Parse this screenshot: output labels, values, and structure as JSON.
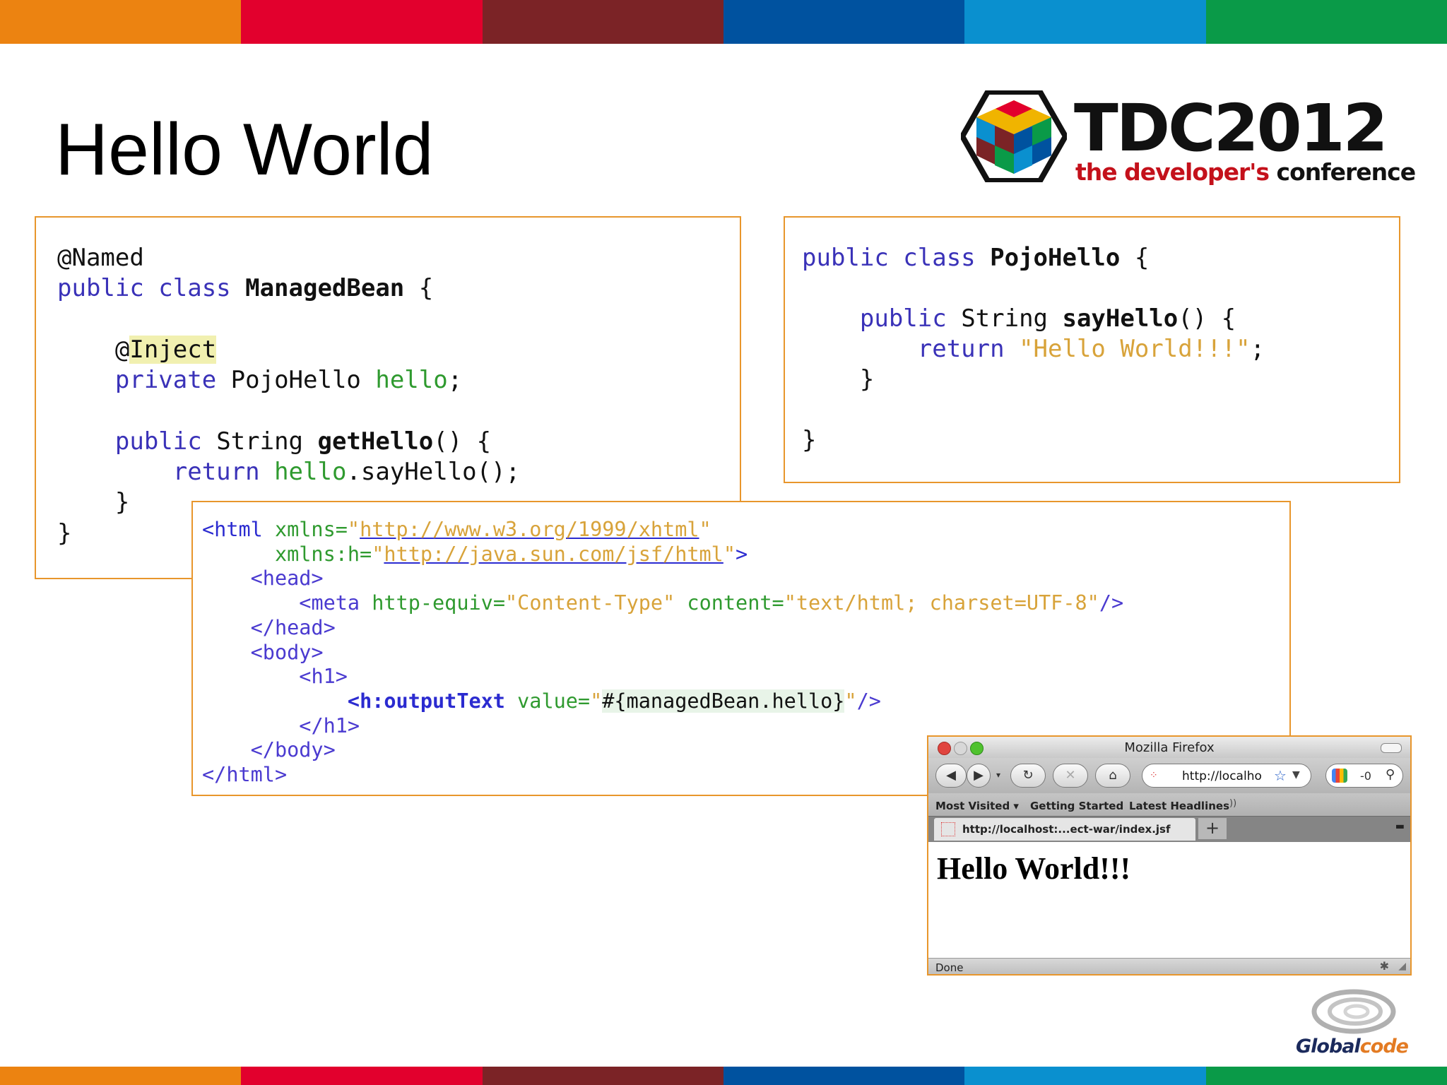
{
  "stripe_colors": [
    "#ec8311",
    "#e2002d",
    "#7b2326",
    "#00529f",
    "#0a90cf",
    "#0a9a48"
  ],
  "slide": {
    "title": "Hello World"
  },
  "tdc_logo": {
    "name": "TDC2012",
    "tagline_part1": "the developer's",
    "tagline_part2": "conference"
  },
  "code_managed_bean": {
    "lines": [
      [
        "@Named",
        null
      ],
      [
        "public class ",
        "ManagedBean",
        " {"
      ],
      [
        "@",
        "Inject"
      ],
      [
        "private ",
        "PojoHello ",
        "hello",
        ";"
      ],
      [
        "public ",
        "String ",
        "getHello",
        "() {"
      ],
      [
        "return ",
        "hello",
        ".sayHello();"
      ],
      [
        "}"
      ],
      [
        "}"
      ]
    ]
  },
  "code_pojo": {
    "line1_kw": "public class ",
    "line1_name": "PojoHello",
    "line1_end": " {",
    "line2_kw": "public ",
    "line2_type": "String ",
    "line2_name": "sayHello",
    "line2_end": "() {",
    "line3_kw": "return ",
    "line3_str": "\"Hello World!!!\"",
    "line3_end": ";",
    "close1": "}",
    "close2": "}"
  },
  "code_xhtml": {
    "xmlns_url": "http://www.w3.org/1999/xhtml",
    "xmlns_h_url": "http://java.sun.com/jsf/html",
    "meta_http_equiv": "Content-Type",
    "meta_content": "text/html; charset=UTF-8",
    "output_value": "#{managedBean.hello}"
  },
  "browser": {
    "window_title": "Mozilla Firefox",
    "url_text": "http://localho",
    "search_text": "-0",
    "bookmarks": [
      "Most Visited",
      "Getting Started",
      "Latest Headlines"
    ],
    "tab_label": "http://localhost:...ect-war/index.jsf",
    "tab_new": "+",
    "page_heading": "Hello World!!!",
    "status": "Done"
  },
  "globalcode_logo": {
    "part1": "Global",
    "part2": "code"
  }
}
